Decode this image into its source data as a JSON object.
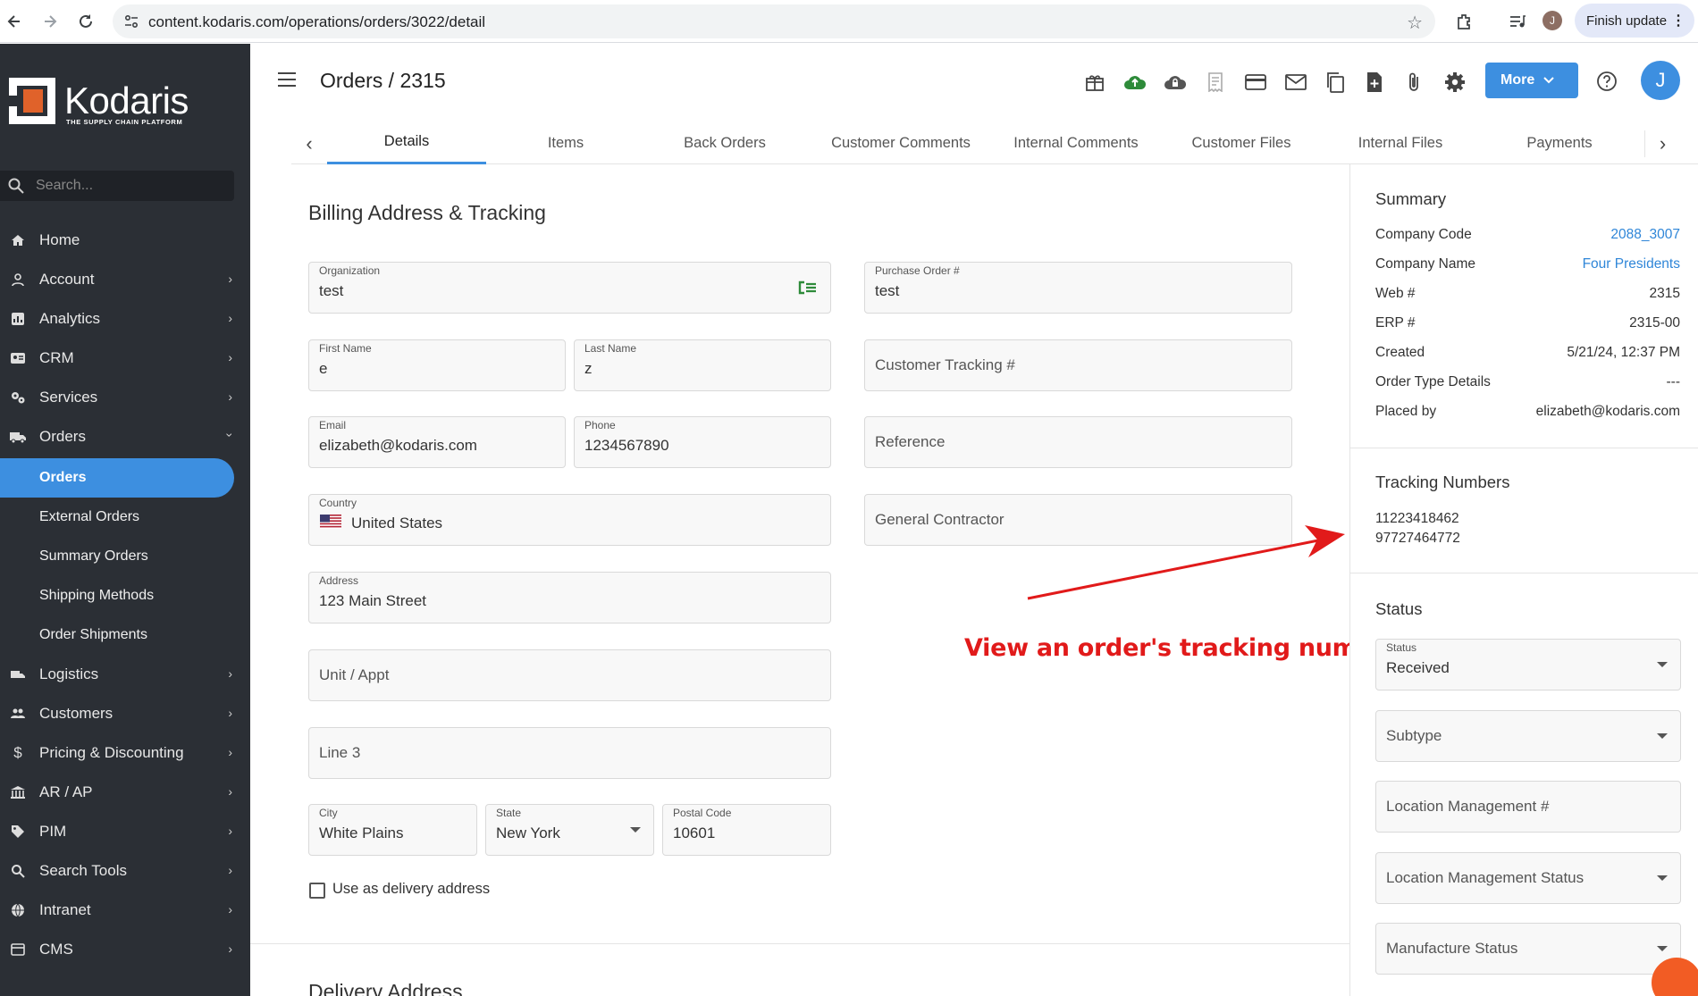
{
  "browser": {
    "url": "content.kodaris.com/operations/orders/3022/detail",
    "profile_initial": "J",
    "finish_update_label": "Finish update"
  },
  "sidebar": {
    "logo_name": "Kodaris",
    "logo_tagline": "THE SUPPLY CHAIN PLATFORM",
    "search_placeholder": "Search...",
    "items": [
      {
        "label": "Home",
        "icon": "home-icon"
      },
      {
        "label": "Account",
        "icon": "person-icon"
      },
      {
        "label": "Analytics",
        "icon": "analytics-icon"
      },
      {
        "label": "CRM",
        "icon": "contact-card-icon"
      },
      {
        "label": "Services",
        "icon": "gears-icon"
      },
      {
        "label": "Orders",
        "icon": "truck-icon"
      },
      {
        "label": "Logistics",
        "icon": "shipping-icon"
      },
      {
        "label": "Customers",
        "icon": "people-icon"
      },
      {
        "label": "Pricing & Discounting",
        "icon": "dollar-icon"
      },
      {
        "label": "AR / AP",
        "icon": "bank-icon"
      },
      {
        "label": "PIM",
        "icon": "tag-icon"
      },
      {
        "label": "Search Tools",
        "icon": "search-icon"
      },
      {
        "label": "Intranet",
        "icon": "globe-icon"
      },
      {
        "label": "CMS",
        "icon": "cms-icon"
      }
    ],
    "orders_subitems": [
      {
        "label": "Orders"
      },
      {
        "label": "External Orders"
      },
      {
        "label": "Summary Orders"
      },
      {
        "label": "Shipping Methods"
      },
      {
        "label": "Order Shipments"
      }
    ]
  },
  "header": {
    "title": "Orders / 2315",
    "more_label": "More",
    "avatar_initial": "J"
  },
  "tabs": [
    "Details",
    "Items",
    "Back Orders",
    "Customer Comments",
    "Internal Comments",
    "Customer Files",
    "Internal Files",
    "Payments"
  ],
  "billing": {
    "title": "Billing Address & Tracking",
    "organization": {
      "label": "Organization",
      "value": "test"
    },
    "purchase_order": {
      "label": "Purchase Order #",
      "value": "test"
    },
    "first_name": {
      "label": "First Name",
      "value": "e"
    },
    "last_name": {
      "label": "Last Name",
      "value": "z"
    },
    "customer_tracking_placeholder": "Customer Tracking #",
    "email": {
      "label": "Email",
      "value": "elizabeth@kodaris.com"
    },
    "phone": {
      "label": "Phone",
      "value": "1234567890"
    },
    "reference_placeholder": "Reference",
    "country": {
      "label": "Country",
      "value": "United States"
    },
    "general_contractor_placeholder": "General Contractor",
    "address": {
      "label": "Address",
      "value": "123 Main Street"
    },
    "unit_placeholder": "Unit / Appt",
    "line3_placeholder": "Line 3",
    "city": {
      "label": "City",
      "value": "White Plains"
    },
    "state": {
      "label": "State",
      "value": "New York"
    },
    "postal": {
      "label": "Postal Code",
      "value": "10601"
    },
    "use_as_delivery_label": "Use as delivery address"
  },
  "delivery": {
    "title": "Delivery Address"
  },
  "summary": {
    "title": "Summary",
    "rows": [
      {
        "label": "Company Code",
        "value": "2088_3007"
      },
      {
        "label": "Company Name",
        "value": "Four Presidents"
      },
      {
        "label": "Web #",
        "value": "2315"
      },
      {
        "label": "ERP #",
        "value": "2315-00"
      },
      {
        "label": "Created",
        "value": "5/21/24, 12:37 PM"
      },
      {
        "label": "Order Type Details",
        "value": "---"
      },
      {
        "label": "Placed by",
        "value": "elizabeth@kodaris.com"
      }
    ]
  },
  "tracking": {
    "title": "Tracking Numbers",
    "numbers": [
      "11223418462",
      "97727464772"
    ]
  },
  "status": {
    "title": "Status",
    "status_field": {
      "label": "Status",
      "value": "Received"
    },
    "subtype_placeholder": "Subtype",
    "location_mgmt_placeholder": "Location Management #",
    "location_mgmt_status_placeholder": "Location Management Status",
    "manufacture_status_placeholder": "Manufacture Status"
  },
  "annotation": {
    "text": "View an order's tracking numbers",
    "color": "#e11a1a"
  },
  "colors": {
    "accent": "#3d8fe0",
    "sidebar_bg": "#2b2f35",
    "link": "#2f86d8",
    "logo_orange": "#e0622a"
  }
}
